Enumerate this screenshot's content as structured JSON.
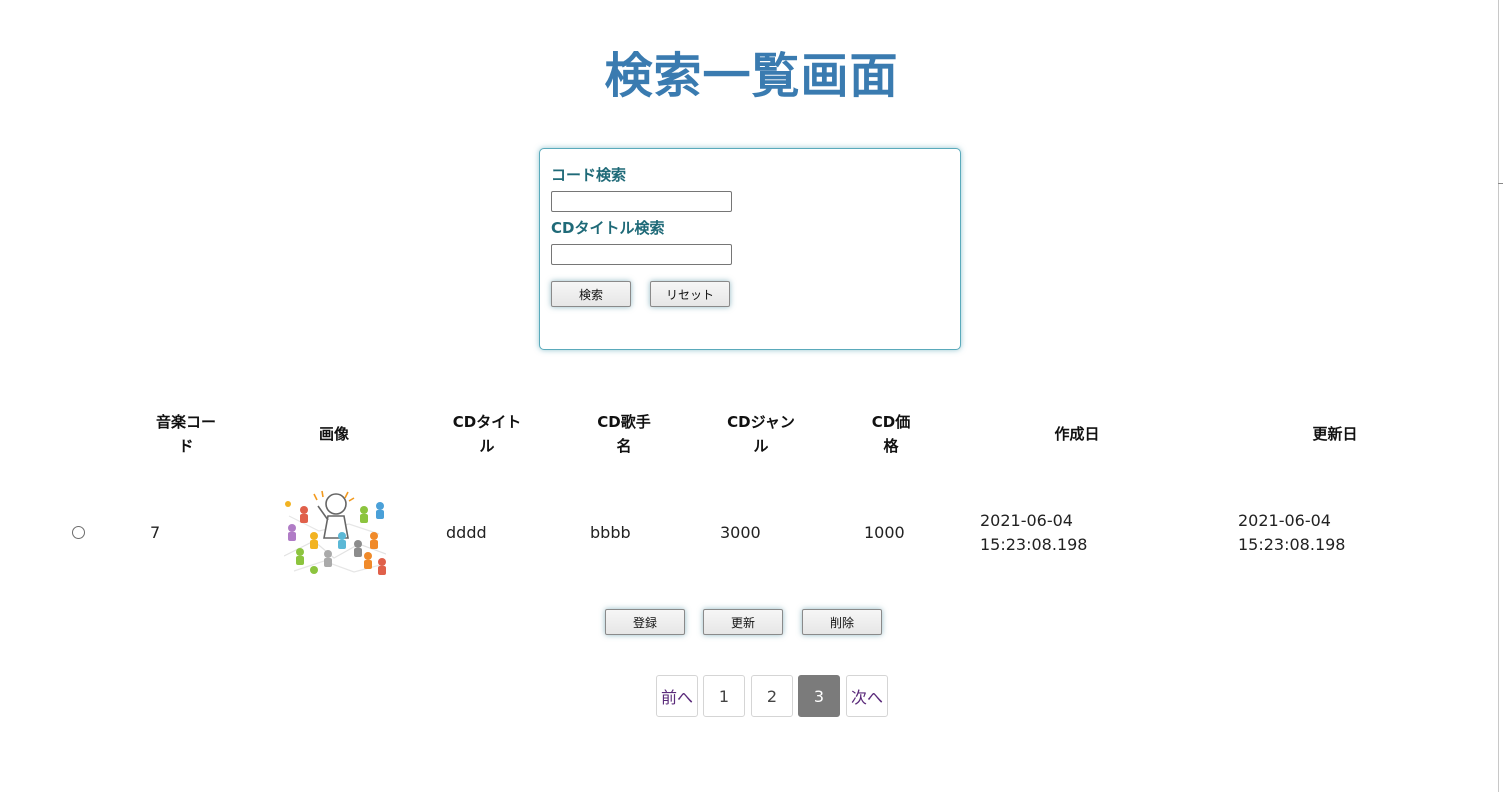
{
  "page": {
    "title": "検索一覧画面"
  },
  "search": {
    "code_label": "コード検索",
    "code_value": "",
    "title_label": "CDタイトル検索",
    "title_value": "",
    "search_button": "検索",
    "reset_button": "リセット"
  },
  "table": {
    "headers": {
      "code_line1": "音楽コー",
      "code_line2": "ド",
      "image": "画像",
      "title_line1": "CDタイト",
      "title_line2": "ル",
      "artist_line1": "CD歌手",
      "artist_line2": "名",
      "genre_line1": "CDジャン",
      "genre_line2": "ル",
      "price_line1": "CD価",
      "price_line2": "格",
      "created": "作成日",
      "updated": "更新日"
    },
    "rows": [
      {
        "selected": false,
        "code": "7",
        "image": "people-network-illustration",
        "title": "dddd",
        "artist": "bbbb",
        "genre": "3000",
        "price": "1000",
        "created_date": "2021-06-04",
        "created_time": "15:23:08.198",
        "updated_date": "2021-06-04",
        "updated_time": "15:23:08.198"
      }
    ]
  },
  "actions": {
    "register": "登録",
    "update": "更新",
    "delete": "削除"
  },
  "pagination": {
    "prev": "前へ",
    "pages": [
      "1",
      "2",
      "3"
    ],
    "current": "3",
    "next": "次へ"
  },
  "colors": {
    "title": "#3a7bb0",
    "label": "#1f6a78",
    "panel_border": "#5aaabb",
    "active_page": "#7b7b7b"
  }
}
